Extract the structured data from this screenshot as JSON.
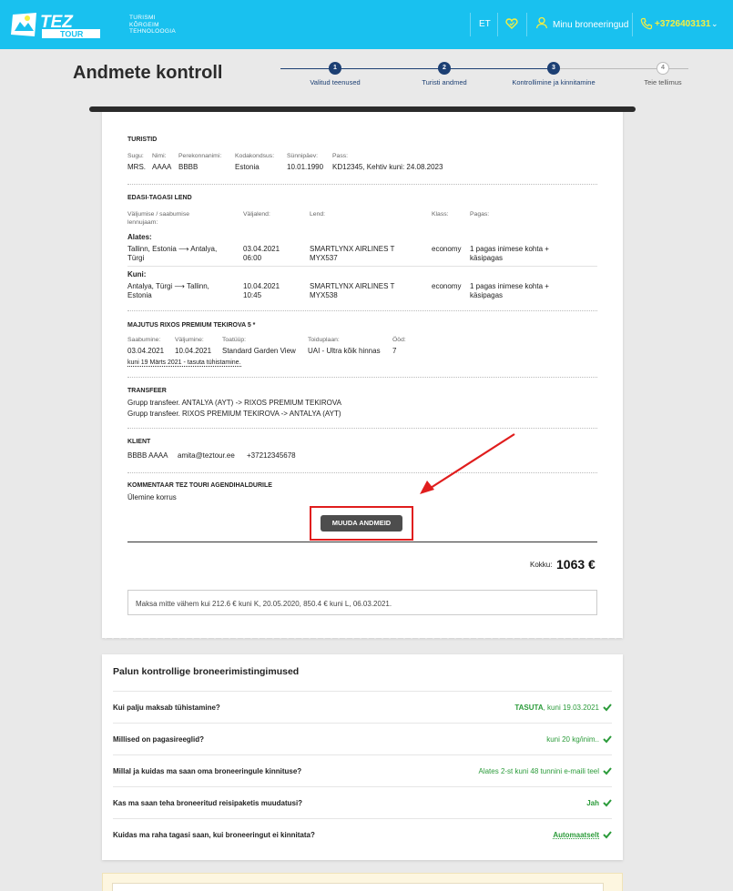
{
  "header": {
    "logo_text": "TEZ TOUR",
    "tagline": [
      "Turismi",
      "Kõrgeim",
      "Tehnoloogia"
    ],
    "lang": "ET",
    "my_bookings": "Minu broneeringud",
    "phone": "+3726403131",
    "phone_chevron": "⌄",
    "colors": {
      "bar": "#19c1ef",
      "phone": "#f7ef40"
    }
  },
  "page_title": "Andmete kontroll",
  "stepper": {
    "steps": [
      {
        "num": "1",
        "label": "Valitud teenused",
        "state": "done"
      },
      {
        "num": "2",
        "label": "Turisti andmed",
        "state": "done"
      },
      {
        "num": "3",
        "label": "Kontrollimine ja kinnitamine",
        "state": "current"
      },
      {
        "num": "4",
        "label": "Teie tellimus",
        "state": "pending"
      }
    ]
  },
  "tourists": {
    "title": "TURISTID",
    "labels": [
      "Sugu:",
      "Nimi:",
      "Perekonnanimi:",
      "Kodakondsus:",
      "Sünnipäev:",
      "Pass:"
    ],
    "values": [
      "MRS.",
      "AAAA",
      "BBBB",
      "Estonia",
      "10.01.1990",
      "KD12345, Kehtiv kuni: 24.08.2023"
    ]
  },
  "flight": {
    "title": "EDASI-TAGASI LEND",
    "labels": [
      "Väljumise / saabumise lennujaam:",
      "Väljalend:",
      "Lend:",
      "Klass:",
      "Pagas:"
    ],
    "outbound": {
      "heading": "Alates:",
      "route": "Tallinn, Estonia ⟶ Antalya, Türgi",
      "date": "03.04.2021",
      "time": "06:00",
      "airline": "SMARTLYNX AIRLINES T",
      "flight_no": "MYX537",
      "class": "economy",
      "baggage": "1 pagas inimese kohta + käsipagas"
    },
    "inbound": {
      "heading": "Kuni:",
      "route": "Antalya, Türgi ⟶ Tallinn, Estonia",
      "date": "10.04.2021",
      "time": "10:45",
      "airline": "SMARTLYNX AIRLINES T",
      "flight_no": "MYX538",
      "class": "economy",
      "baggage": "1 pagas inimese kohta + käsipagas"
    }
  },
  "hotel": {
    "title": "MAJUTUS RIXOS PREMIUM TEKIROVA 5 *",
    "labels": [
      "Saabumine:",
      "Väljumine:",
      "Toatüüp:",
      "Toiduplaan:",
      "Ööd:"
    ],
    "values": [
      "03.04.2021",
      "10.04.2021",
      "Standard Garden View",
      "UAI - Ultra kõik hinnas",
      "7"
    ],
    "cancel_note": "kuni 19 Märts 2021 - tasuta tühistamine."
  },
  "transfer": {
    "title": "TRANSFEER",
    "lines": [
      "Grupp transfeer. ANTALYA (AYT) -> RIXOS PREMIUM TEKIROVA",
      "Grupp transfeer. RIXOS PREMIUM TEKIROVA -> ANTALYA (AYT)"
    ]
  },
  "client": {
    "title": "KLIENT",
    "name": "BBBB AAAA",
    "email": "amita@teztour.ee",
    "phone": "+37212345678"
  },
  "comment": {
    "title": "KOMMENTAAR TEZ TOURI AGENDIHALDURILE",
    "text": "Ülemine korrus"
  },
  "edit_button": "MUUDA ANDMEID",
  "total": {
    "label": "Kokku:",
    "value": "1063 €"
  },
  "payment_note": "Maksa mitte vähem kui 212.6 € kuni K, 20.05.2020, 850.4 € kuni L, 06.03.2021.",
  "conditions": {
    "title": "Palun kontrollige broneerimistingimused",
    "rows": [
      {
        "q": "Kui palju maksab tühistamine?",
        "a_bold": "TASUTA",
        "a": ", kuni 19.03.2021"
      },
      {
        "q": "Millised on pagasireeglid?",
        "a_bold": "",
        "a": "kuni 20 kg/inim.."
      },
      {
        "q": "Millal ja kuidas ma saan oma broneeringule kinnituse?",
        "a_bold": "",
        "a": "Alates 2-st kuni 48 tunnini e-maili teel"
      },
      {
        "q": "Kas ma saan teha broneeritud reisipaketis muudatusi?",
        "a_bold": "Jah",
        "a": ""
      },
      {
        "q": "Kuidas ma raha tagasi saan, kui broneeringut ei kinnitata?",
        "a_bold": "Automaatselt",
        "a": ""
      }
    ],
    "answer_color": "#2b9b3a"
  }
}
